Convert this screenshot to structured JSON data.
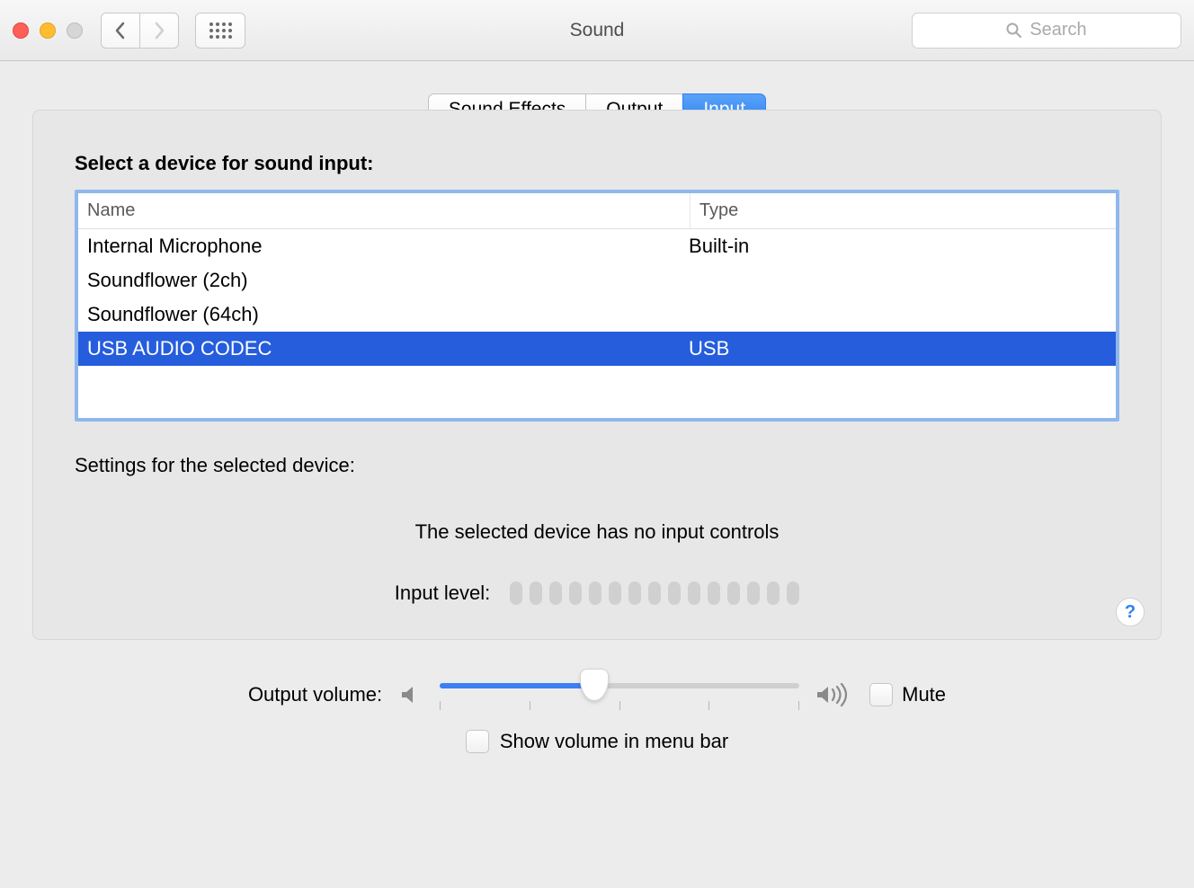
{
  "window": {
    "title": "Sound"
  },
  "search": {
    "placeholder": "Search"
  },
  "tabs": {
    "soundEffects": "Sound Effects",
    "output": "Output",
    "input": "Input"
  },
  "panel": {
    "heading": "Select a device for sound input:",
    "columns": {
      "name": "Name",
      "type": "Type"
    },
    "devices": [
      {
        "name": "Internal Microphone",
        "type": "Built-in",
        "selected": false
      },
      {
        "name": "Soundflower (2ch)",
        "type": "",
        "selected": false
      },
      {
        "name": "Soundflower (64ch)",
        "type": "",
        "selected": false
      },
      {
        "name": "USB AUDIO  CODEC",
        "type": "USB",
        "selected": true
      }
    ],
    "settingsHeading": "Settings for the selected device:",
    "noControls": "The selected device has no input controls",
    "inputLevelLabel": "Input level:",
    "inputLevelSegments": 15
  },
  "volume": {
    "label": "Output volume:",
    "positionPercent": 43,
    "muteLabel": "Mute",
    "muteChecked": false
  },
  "menubar": {
    "label": "Show volume in menu bar",
    "checked": false
  },
  "helpSymbol": "?"
}
